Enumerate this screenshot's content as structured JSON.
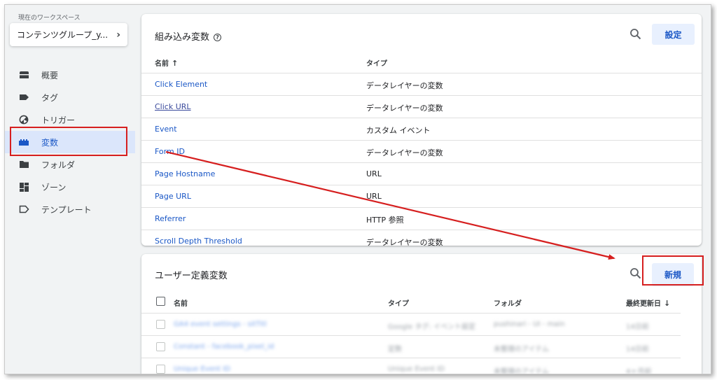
{
  "workspace": {
    "label": "現在のワークスペース",
    "name": "コンテンツグループ_y...",
    "chevron": "›"
  },
  "nav": [
    {
      "label": "概要",
      "icon": "overview-icon"
    },
    {
      "label": "タグ",
      "icon": "tag-icon"
    },
    {
      "label": "トリガー",
      "icon": "trigger-icon"
    },
    {
      "label": "変数",
      "icon": "variables-icon",
      "active": true
    },
    {
      "label": "フォルダ",
      "icon": "folder-icon"
    },
    {
      "label": "ゾーン",
      "icon": "zone-icon"
    },
    {
      "label": "テンプレート",
      "icon": "template-icon"
    }
  ],
  "builtin": {
    "title": "組み込み変数",
    "help": "?",
    "configure_label": "設定",
    "col_name": "名前",
    "col_type": "タイプ",
    "sort_arrow": "↑",
    "rows": [
      {
        "name": "Click Element",
        "type": "データレイヤーの変数"
      },
      {
        "name": "Click URL",
        "type": "データレイヤーの変数"
      },
      {
        "name": "Event",
        "type": "カスタム イベント"
      },
      {
        "name": "Form ID",
        "type": "データレイヤーの変数"
      },
      {
        "name": "Page Hostname",
        "type": "URL"
      },
      {
        "name": "Page URL",
        "type": "URL"
      },
      {
        "name": "Referrer",
        "type": "HTTP 参照"
      },
      {
        "name": "Scroll Depth Threshold",
        "type": "データレイヤーの変数"
      }
    ]
  },
  "userdefined": {
    "title": "ユーザー定義変数",
    "new_label": "新規",
    "col_name": "名前",
    "col_type": "タイプ",
    "col_folder": "フォルダ",
    "col_updated": "最終更新日",
    "sort_arrow": "↓",
    "rows": [
      {
        "name": "GA4 event settings - sitTitl",
        "type": "Google タグ: イベント設定",
        "folder": "pushinari - UI - main",
        "updated": "14日前"
      },
      {
        "name": "Constant - facebook_pixel_id",
        "type": "定数",
        "folder": "未整理のアイテム",
        "updated": "14日前"
      },
      {
        "name": "Unique Event ID",
        "type": "Unique Event ID",
        "folder": "未整理のアイテム",
        "updated": "4ヶ月前"
      }
    ]
  },
  "colors": {
    "accent": "#1a57c6",
    "highlight": "#d61f1f",
    "background": "#f1f3f4"
  }
}
